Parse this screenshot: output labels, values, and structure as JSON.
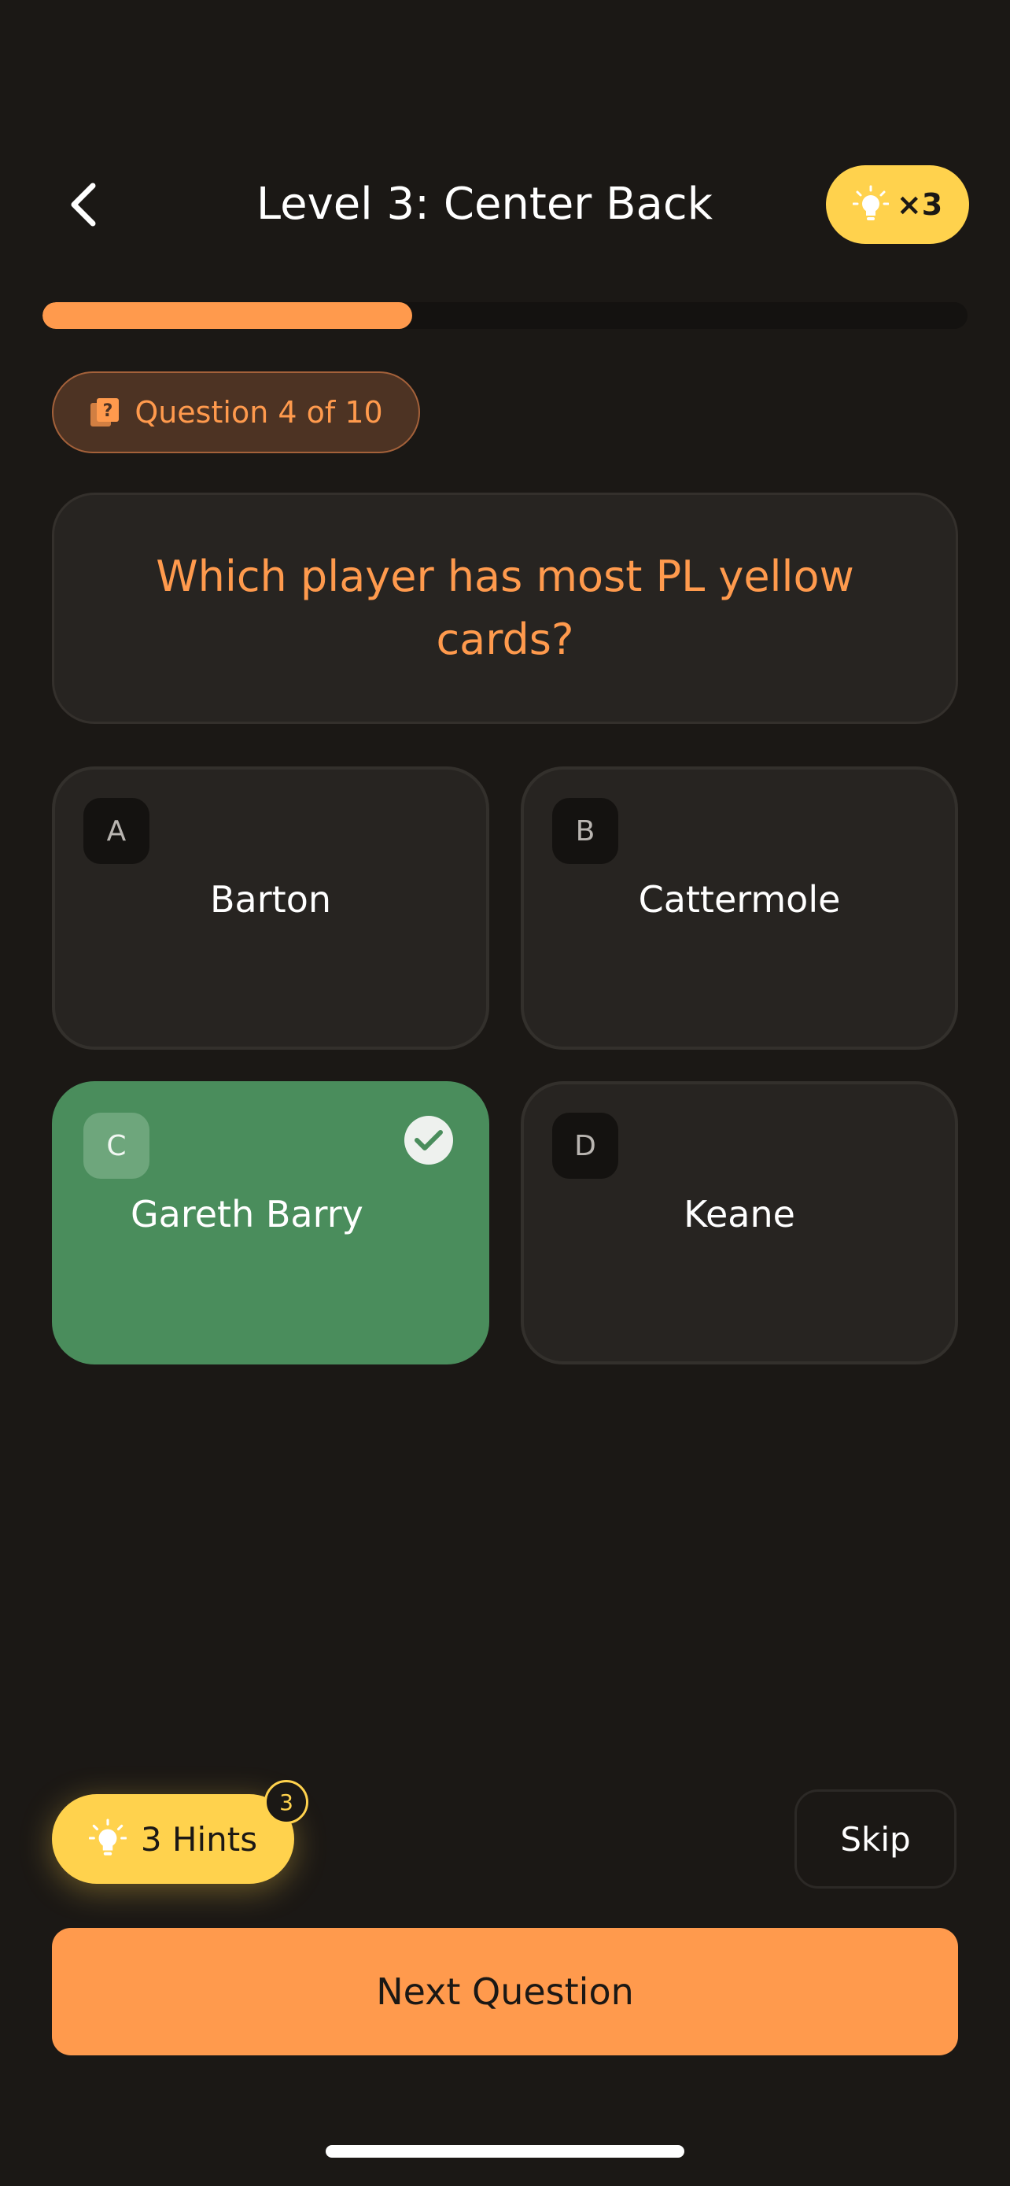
{
  "header": {
    "title": "Level 3: Center Back",
    "hint_multiplier": "×3"
  },
  "progress": {
    "fraction": 0.4
  },
  "question": {
    "counter": "Question 4 of 10",
    "text": "Which player has most PL yellow cards?"
  },
  "options": [
    {
      "letter": "A",
      "text": "Barton",
      "state": "default"
    },
    {
      "letter": "B",
      "text": "Cattermole",
      "state": "default"
    },
    {
      "letter": "C",
      "text": "Gareth Barry",
      "state": "correct"
    },
    {
      "letter": "D",
      "text": "Keane",
      "state": "default"
    }
  ],
  "footer": {
    "hints_label": "3 Hints",
    "hints_count": "3",
    "skip_label": "Skip",
    "next_label": "Next Question"
  },
  "colors": {
    "background": "#1b1815",
    "accent_orange": "#ff9a4d",
    "hint_yellow": "#ffd24d",
    "correct_green": "#4a8d5c"
  },
  "icons": {
    "back": "chevron-left-icon",
    "hint": "lightbulb-icon",
    "question": "question-book-icon",
    "correct": "check-icon"
  }
}
